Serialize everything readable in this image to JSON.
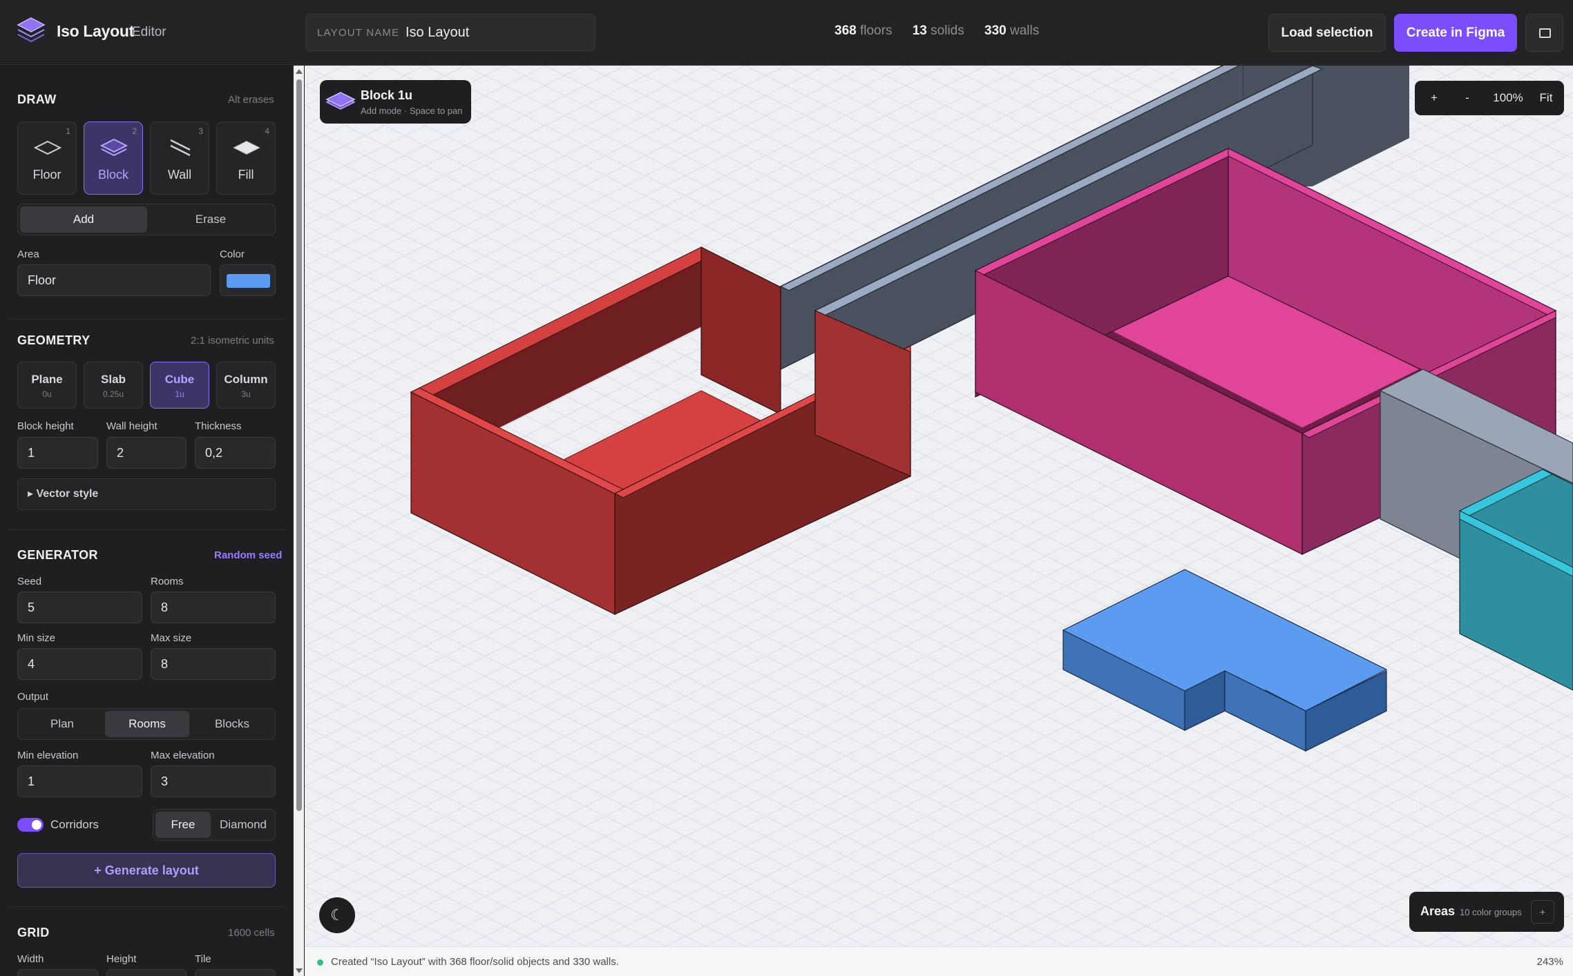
{
  "app": {
    "title": "Iso Layout",
    "subtitle": "Editor",
    "logo_icon": "layers-icon"
  },
  "layout_name": {
    "label": "LAYOUT NAME",
    "value": "Iso Layout"
  },
  "stats": [
    {
      "value": "368",
      "label": "floors"
    },
    {
      "value": "13",
      "label": "solids"
    },
    {
      "value": "330",
      "label": "walls"
    }
  ],
  "header_buttons": {
    "load": "Load selection",
    "create": "Create in Figma",
    "panel_icon": "panel-toggle-icon"
  },
  "draw": {
    "title": "DRAW",
    "hint": "Alt erases",
    "tools": [
      {
        "label": "Floor",
        "shortcut": "1",
        "icon": "floor-icon"
      },
      {
        "label": "Block",
        "shortcut": "2",
        "icon": "block-icon",
        "active": true
      },
      {
        "label": "Wall",
        "shortcut": "3",
        "icon": "wall-icon"
      },
      {
        "label": "Fill",
        "shortcut": "4",
        "icon": "fill-icon"
      }
    ],
    "modes": [
      "Add",
      "Erase"
    ],
    "area_label": "Area",
    "area_value": "Floor",
    "color_label": "Color",
    "color_value": "#5b9cf0"
  },
  "geometry": {
    "title": "GEOMETRY",
    "hint": "2:1 isometric units",
    "types": [
      {
        "label": "Plane",
        "unit": "0u"
      },
      {
        "label": "Slab",
        "unit": "0.25u"
      },
      {
        "label": "Cube",
        "unit": "1u",
        "active": true
      },
      {
        "label": "Column",
        "unit": "3u"
      }
    ],
    "block_height_label": "Block height",
    "block_height": "1",
    "wall_height_label": "Wall height",
    "wall_height": "2",
    "thickness_label": "Thickness",
    "thickness": "0,2",
    "vector_style": "▸ Vector style"
  },
  "generator": {
    "title": "GENERATOR",
    "link": "Random seed",
    "seed_label": "Seed",
    "seed": "5",
    "rooms_label": "Rooms",
    "rooms": "8",
    "min_size_label": "Min size",
    "min_size": "4",
    "max_size_label": "Max size",
    "max_size": "8",
    "output_label": "Output",
    "outputs": [
      "Plan",
      "Rooms",
      "Blocks"
    ],
    "min_elev_label": "Min elevation",
    "min_elev": "1",
    "max_elev_label": "Max elevation",
    "max_elev": "3",
    "corridors_label": "Corridors",
    "corridor_modes": [
      "Free",
      "Diamond"
    ],
    "generate": "+ Generate layout"
  },
  "grid": {
    "title": "GRID",
    "hint": "1600 cells",
    "width_label": "Width",
    "height_label": "Height",
    "tile_label": "Tile"
  },
  "canvas": {
    "badge_title": "Block 1u",
    "badge_sub": "Add mode · Space to pan",
    "zoom_in": "+",
    "zoom_out": "-",
    "zoom_level": "100%",
    "fit": "Fit",
    "theme_icon": "moon-icon",
    "theme_glyph": "☾",
    "areas_title": "Areas",
    "areas_sub": "10 color groups",
    "areas_btn": "+"
  },
  "status": {
    "text": "Created “Iso Layout” with 368 floor/solid objects and 330 walls.",
    "zoom": "243%"
  },
  "colors": {
    "accent": "#7c4dff",
    "red_room": "#a33131",
    "pink_room": "#c23a7d",
    "blue_block": "#5b9cf0",
    "teal_room": "#2ea3b5",
    "wall_grey": "#4a5260"
  }
}
